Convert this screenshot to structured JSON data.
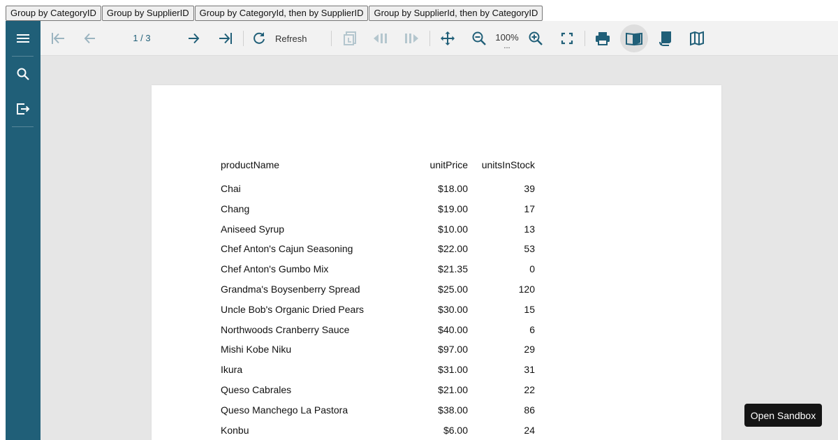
{
  "group_buttons": [
    "Group by CategoryID",
    "Group by SupplierID",
    "Group by CategoryId, then by SupplierID",
    "Group by SupplierId, then by CategoryID"
  ],
  "toolbar": {
    "page_indicator": "1 / 3",
    "refresh_label": "Refresh",
    "zoom": "100%",
    "zoom_more": "...",
    "active_view": "single-page-view"
  },
  "report": {
    "columns": [
      "productName",
      "unitPrice",
      "unitsInStock"
    ],
    "rows": [
      [
        "Chai",
        "$18.00",
        "39"
      ],
      [
        "Chang",
        "$19.00",
        "17"
      ],
      [
        "Aniseed Syrup",
        "$10.00",
        "13"
      ],
      [
        "Chef Anton's Cajun Seasoning",
        "$22.00",
        "53"
      ],
      [
        "Chef Anton's Gumbo Mix",
        "$21.35",
        "0"
      ],
      [
        "Grandma's Boysenberry Spread",
        "$25.00",
        "120"
      ],
      [
        "Uncle Bob's Organic Dried Pears",
        "$30.00",
        "15"
      ],
      [
        "Northwoods Cranberry Sauce",
        "$40.00",
        "6"
      ],
      [
        "Mishi Kobe Niku",
        "$97.00",
        "29"
      ],
      [
        "Ikura",
        "$31.00",
        "31"
      ],
      [
        "Queso Cabrales",
        "$21.00",
        "22"
      ],
      [
        "Queso Manchego La Pastora",
        "$38.00",
        "86"
      ],
      [
        "Konbu",
        "$6.00",
        "24"
      ]
    ]
  },
  "sandbox_button": "Open Sandbox",
  "colors": {
    "sidebar": "#205f78",
    "accent": "#205f78",
    "toolbar_bg": "#f2f2f2",
    "viewer_bg": "#e6e6e6"
  },
  "icons": {
    "sidebar": [
      "hamburger-menu-icon",
      "search-icon",
      "export-icon"
    ],
    "toolbar": [
      "first-page-icon",
      "previous-page-icon",
      "next-page-icon",
      "last-page-icon",
      "refresh-icon",
      "parent-report-icon",
      "previous-section-icon",
      "next-section-icon",
      "pan-mode-icon",
      "zoom-out-icon",
      "zoom-in-icon",
      "fullscreen-icon",
      "print-icon",
      "single-page-view-icon",
      "continuous-view-icon",
      "galley-view-icon"
    ]
  }
}
